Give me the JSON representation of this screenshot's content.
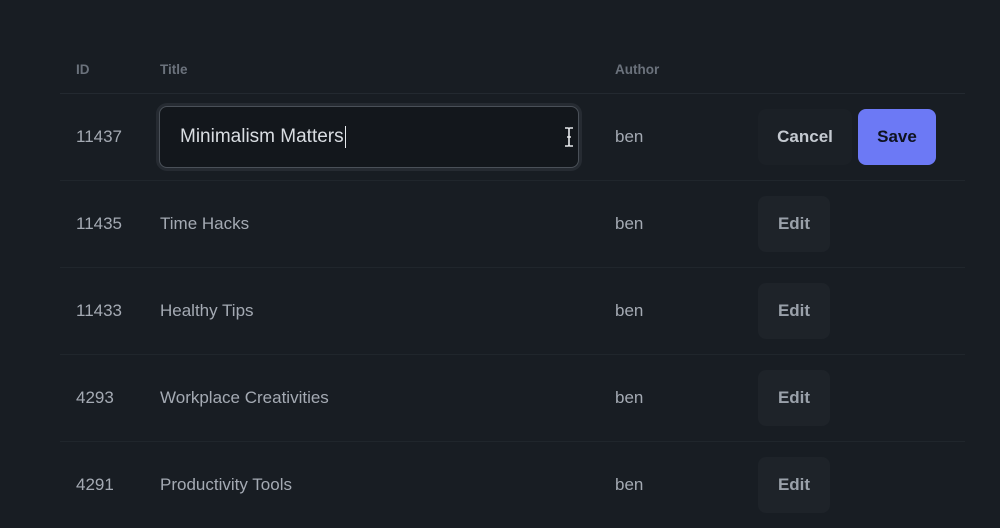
{
  "table": {
    "headers": {
      "id": "ID",
      "title": "Title",
      "author": "Author"
    },
    "editing_row": {
      "id": "11437",
      "title_value": "Minimalism Matters",
      "author": "ben",
      "cancel_label": "Cancel",
      "save_label": "Save"
    },
    "rows": [
      {
        "id": "11435",
        "title": "Time Hacks",
        "author": "ben",
        "action_label": "Edit"
      },
      {
        "id": "11433",
        "title": "Healthy Tips",
        "author": "ben",
        "action_label": "Edit"
      },
      {
        "id": "4293",
        "title": "Workplace Creativities",
        "author": "ben",
        "action_label": "Edit"
      },
      {
        "id": "4291",
        "title": "Productivity Tools",
        "author": "ben",
        "action_label": "Edit"
      }
    ]
  },
  "colors": {
    "background": "#181d23",
    "accent": "#6c79f5"
  },
  "icons": {
    "cursor": "text-cursor-icon"
  }
}
